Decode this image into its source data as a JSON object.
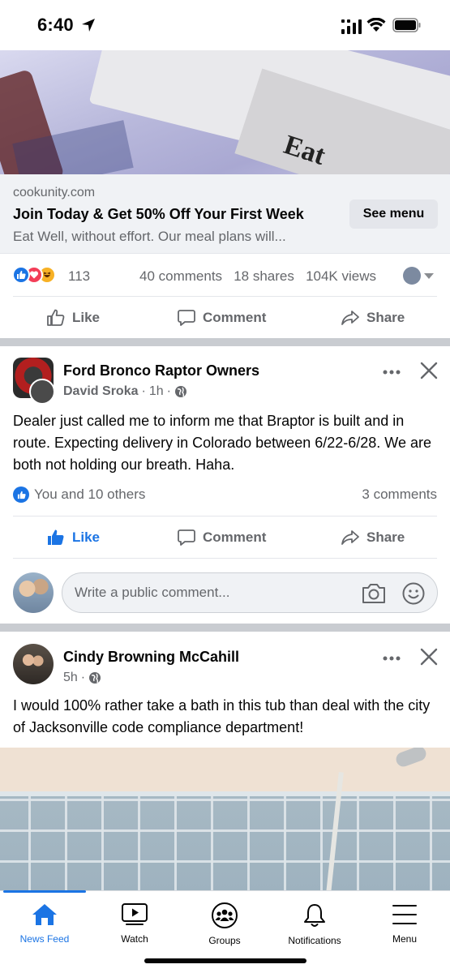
{
  "status_bar": {
    "time": "6:40"
  },
  "ad": {
    "domain": "cookunity.com",
    "headline": "Join Today & Get 50% Off Your First Week",
    "description": "Eat Well, without effort. Our meal plans will...",
    "cta_label": "See menu",
    "reaction_count": "113",
    "comments": "40 comments",
    "shares": "18 shares",
    "views": "104K views"
  },
  "actions": {
    "like": "Like",
    "comment": "Comment",
    "share": "Share"
  },
  "post1": {
    "group_name": "Ford Bronco Raptor Owners",
    "author": "David Sroka",
    "time": "1h",
    "text": "Dealer just called me to inform me that Braptor is built and in route. Expecting delivery in Colorado between 6/22-6/28. We are both not holding our breath. Haha.",
    "likes_text": "You and 10 others",
    "comments": "3 comments"
  },
  "composer": {
    "placeholder": "Write a public comment..."
  },
  "post2": {
    "author": "Cindy Browning McCahill",
    "time": "5h",
    "text": "I would 100% rather take a bath in this tub than deal with the city of Jacksonville code compliance department!"
  },
  "tabs": [
    {
      "label": "News Feed",
      "icon": "home-icon",
      "active": true
    },
    {
      "label": "Watch",
      "icon": "video-icon",
      "active": false
    },
    {
      "label": "Groups",
      "icon": "groups-icon",
      "active": false
    },
    {
      "label": "Notifications",
      "icon": "bell-icon",
      "active": false
    },
    {
      "label": "Menu",
      "icon": "hamburger-icon",
      "active": false
    }
  ],
  "colors": {
    "accent": "#1b74e4",
    "secondary_text": "#65676b",
    "separator": "#c9ccd1"
  }
}
